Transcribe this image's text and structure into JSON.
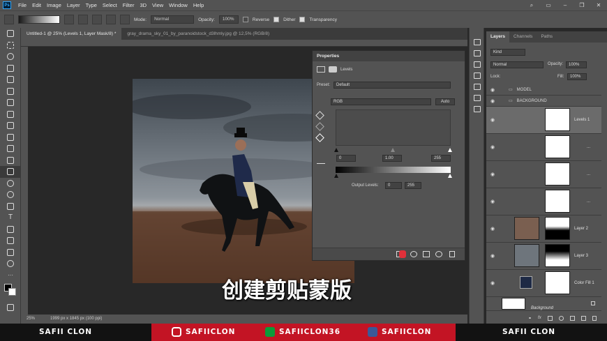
{
  "menu": {
    "logo": "Ps",
    "items": [
      "File",
      "Edit",
      "Image",
      "Layer",
      "Type",
      "Select",
      "Filter",
      "3D",
      "View",
      "Window",
      "Help"
    ]
  },
  "options": {
    "mode_label": "Mode:",
    "mode_value": "Normal",
    "opacity_label": "Opacity:",
    "opacity_value": "100%",
    "reverse": "Reverse",
    "dither": "Dither",
    "transparency": "Transparency"
  },
  "tabs": [
    "Untitled-1 @ 25% (Levels 1, Layer Mask/8) *",
    "gray_drama_sky_01_by_paranoidstock_d3lhmly.jpg @ 12,5% (RGB/8)"
  ],
  "status": {
    "zoom": "25%",
    "doc": "1999 px x 1845 px (100 ppi)"
  },
  "properties": {
    "title": "Properties",
    "subtitle": "Levels",
    "preset_label": "Preset:",
    "preset_value": "Default",
    "channel": "RGB",
    "auto": "Auto",
    "input_black": "0",
    "input_mid": "1.00",
    "input_white": "255",
    "output_label": "Output Levels:",
    "output_black": "0",
    "output_white": "255"
  },
  "layers_panel": {
    "tabs": [
      "Layers",
      "Channels",
      "Paths"
    ],
    "kind": "Kind",
    "blend": "Normal",
    "opacity_label": "Opacity:",
    "opacity_value": "100%",
    "lock_label": "Lock:",
    "fill_label": "Fill:",
    "fill_value": "100%",
    "groups": [
      "MODEL",
      "BACKGROUND"
    ],
    "layers": [
      {
        "name": "Levels 1"
      },
      {
        "name": "..."
      },
      {
        "name": "..."
      },
      {
        "name": "..."
      },
      {
        "name": "Layer 2"
      },
      {
        "name": "Layer 3"
      },
      {
        "name": "Color Fill 1"
      },
      {
        "name": "Background"
      }
    ]
  },
  "caption": "创建剪贴蒙版",
  "footer": {
    "left": "SAFII CLON",
    "instagram": "SAFIICLON",
    "xbox": "SAFIICLON36",
    "facebook": "SAFIICLON",
    "right": "SAFII CLON"
  },
  "colors": {
    "accent_red": "#c31424",
    "ui_gray": "#535353",
    "dark": "#282828"
  }
}
